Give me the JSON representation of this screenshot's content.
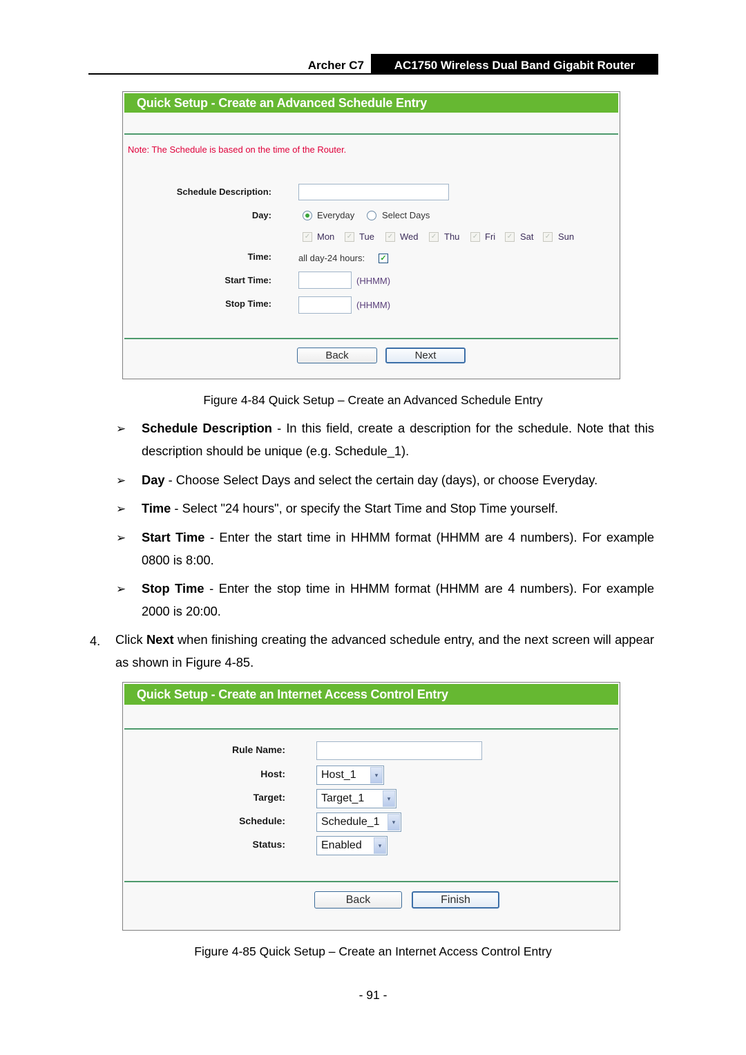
{
  "running_header": {
    "model": "Archer C7",
    "product": "AC1750 Wireless Dual Band Gigabit Router"
  },
  "figure84": {
    "title": "Quick Setup - Create an Advanced Schedule Entry",
    "note": "Note: The Schedule is based on the time of the Router.",
    "schedule_description_label": "Schedule Description:",
    "schedule_description_value": "",
    "day_label": "Day:",
    "day_options": [
      {
        "label": "Everyday",
        "selected": true
      },
      {
        "label": "Select Days",
        "selected": false
      }
    ],
    "days": [
      {
        "label": "Mon",
        "checked": true,
        "enabled": false
      },
      {
        "label": "Tue",
        "checked": true,
        "enabled": false
      },
      {
        "label": "Wed",
        "checked": true,
        "enabled": false
      },
      {
        "label": "Thu",
        "checked": true,
        "enabled": false
      },
      {
        "label": "Fri",
        "checked": true,
        "enabled": false
      },
      {
        "label": "Sat",
        "checked": true,
        "enabled": false
      },
      {
        "label": "Sun",
        "checked": true,
        "enabled": false
      }
    ],
    "time_label": "Time:",
    "all_day_label": "all day-24 hours:",
    "all_day_checked": true,
    "start_time_label": "Start Time:",
    "start_time_value": "",
    "stop_time_label": "Stop Time:",
    "stop_time_value": "",
    "format_hint": "(HHMM)",
    "back_label": "Back",
    "next_label": "Next",
    "caption": "Figure 4-84 Quick Setup – Create an Advanced Schedule Entry"
  },
  "bullets": [
    {
      "term": "Schedule Description",
      "text": " - In this field, create a description for the schedule. Note that this description should be unique (e.g. Schedule_1)."
    },
    {
      "term": "Day",
      "text": " - Choose Select Days and select the certain day (days), or choose Everyday."
    },
    {
      "term": "Time",
      "text": " - Select \"24 hours\", or specify the Start Time and Stop Time yourself."
    },
    {
      "term": "Start Time",
      "text": " - Enter the start time in HHMM format (HHMM are 4 numbers). For example 0800 is 8:00."
    },
    {
      "term": "Stop Time",
      "text": " - Enter the stop time in HHMM format (HHMM are 4 numbers). For example 2000 is 20:00."
    }
  ],
  "bullet_glyph": "➢",
  "step4": {
    "number": "4.",
    "pre": "Click ",
    "bold": "Next",
    "post": " when finishing creating the advanced schedule entry, and the next screen will appear as shown in Figure 4-85."
  },
  "figure85": {
    "title": "Quick Setup - Create an Internet Access Control Entry",
    "rule_name_label": "Rule Name:",
    "rule_name_value": "",
    "host_label": "Host:",
    "host_value": "Host_1",
    "target_label": "Target:",
    "target_value": "Target_1",
    "schedule_label": "Schedule:",
    "schedule_value": "Schedule_1",
    "status_label": "Status:",
    "status_value": "Enabled",
    "dropdown_glyph": "▾",
    "back_label": "Back",
    "finish_label": "Finish",
    "caption": "Figure 4-85 Quick Setup – Create an Internet Access Control Entry"
  },
  "page_number": "- 91 -",
  "colors": {
    "header_green": "#66b832",
    "note_red": "#e0003a",
    "divider_green": "#4d9a6c"
  }
}
